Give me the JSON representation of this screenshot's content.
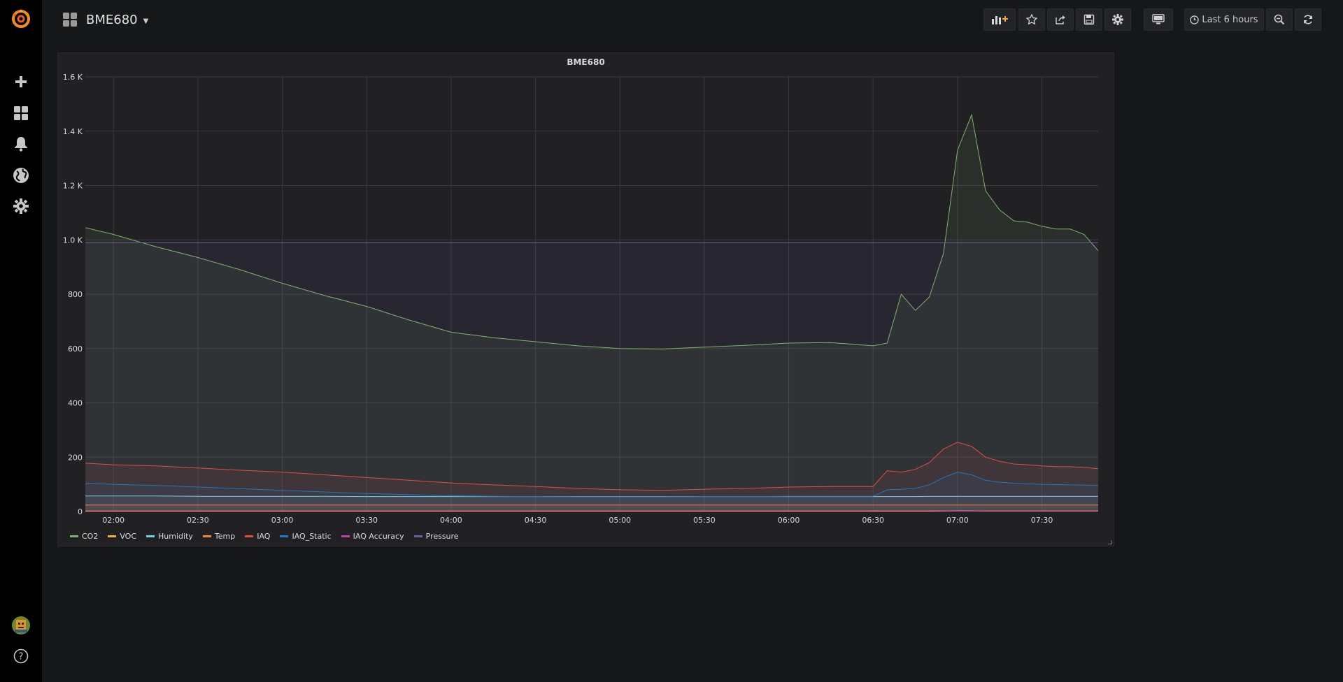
{
  "header": {
    "dashboard_title": "BME680",
    "time_range_label": "Last 6 hours"
  },
  "sidebar": {
    "items": [
      {
        "icon": "grafana-logo-icon"
      },
      {
        "icon": "plus-icon"
      },
      {
        "icon": "dashboards-icon"
      },
      {
        "icon": "bell-icon"
      },
      {
        "icon": "globe-icon"
      },
      {
        "icon": "gear-icon"
      },
      {
        "icon": "avatar"
      },
      {
        "icon": "help-icon"
      }
    ]
  },
  "toolbar": {
    "buttons": [
      {
        "icon": "add-panel-icon"
      },
      {
        "icon": "star-icon"
      },
      {
        "icon": "share-icon"
      },
      {
        "icon": "save-icon"
      },
      {
        "icon": "gear-icon"
      },
      {
        "icon": "monitor-icon"
      },
      {
        "icon": "clock-icon"
      },
      {
        "icon": "zoom-out-icon"
      },
      {
        "icon": "refresh-icon"
      }
    ]
  },
  "panel": {
    "title": "BME680"
  },
  "colors": {
    "CO2": "#7eb26d",
    "VOC": "#eab839",
    "Humidity": "#6ed0e0",
    "Temp": "#ef843c",
    "IAQ": "#e24d42",
    "IAQ_Static": "#1f78c1",
    "IAQ Accuracy": "#ba43a9",
    "Pressure": "#705da0"
  },
  "chart_data": {
    "type": "line",
    "title": "BME680",
    "xlabel": "",
    "ylabel": "",
    "x_ticks": [
      "02:00",
      "02:30",
      "03:00",
      "03:30",
      "04:00",
      "04:30",
      "05:00",
      "05:30",
      "06:00",
      "06:30",
      "07:00",
      "07:30"
    ],
    "y_ticks": [
      "0",
      "200",
      "400",
      "600",
      "800",
      "1.0 K",
      "1.2 K",
      "1.4 K",
      "1.6 K"
    ],
    "ylim": [
      0,
      1600
    ],
    "xlim": [
      "01:50",
      "07:50"
    ],
    "grid": true,
    "legend_position": "bottom-left",
    "x": [
      "01:50",
      "02:00",
      "02:15",
      "02:30",
      "02:45",
      "03:00",
      "03:15",
      "03:30",
      "03:45",
      "04:00",
      "04:15",
      "04:30",
      "04:45",
      "05:00",
      "05:15",
      "05:30",
      "05:45",
      "06:00",
      "06:15",
      "06:30",
      "06:35",
      "06:40",
      "06:45",
      "06:50",
      "06:55",
      "07:00",
      "07:05",
      "07:10",
      "07:15",
      "07:20",
      "07:25",
      "07:30",
      "07:35",
      "07:40",
      "07:45",
      "07:50"
    ],
    "series": [
      {
        "name": "CO2",
        "values": [
          1045,
          1020,
          975,
          935,
          890,
          840,
          795,
          755,
          705,
          660,
          640,
          625,
          610,
          600,
          598,
          605,
          612,
          620,
          622,
          610,
          620,
          800,
          740,
          790,
          950,
          1330,
          1460,
          1180,
          1110,
          1070,
          1065,
          1050,
          1040,
          1040,
          1020,
          960
        ]
      },
      {
        "name": "VOC",
        "values": [
          1,
          1,
          1,
          1,
          1,
          1,
          1,
          1,
          1,
          1,
          1,
          1,
          1,
          1,
          1,
          1,
          1,
          1,
          1,
          1,
          1,
          1,
          1,
          1,
          2,
          3,
          3,
          2,
          2,
          2,
          2,
          2,
          2,
          2,
          2,
          2
        ]
      },
      {
        "name": "Humidity",
        "values": [
          57,
          57,
          57,
          56,
          56,
          56,
          56,
          55,
          55,
          55,
          55,
          55,
          55,
          55,
          55,
          55,
          55,
          55,
          55,
          55,
          55,
          55,
          55,
          56,
          56,
          56,
          56,
          56,
          56,
          56,
          56,
          56,
          56,
          56,
          56,
          56
        ]
      },
      {
        "name": "Temp",
        "values": [
          24,
          24,
          24,
          24,
          24,
          24,
          24,
          24,
          24,
          24,
          24,
          24,
          24,
          24,
          24,
          24,
          24,
          24,
          24,
          24,
          24,
          24,
          24,
          24,
          24,
          24,
          24,
          24,
          24,
          24,
          24,
          24,
          24,
          24,
          24,
          24
        ]
      },
      {
        "name": "IAQ",
        "values": [
          178,
          172,
          168,
          160,
          152,
          145,
          135,
          125,
          115,
          105,
          98,
          92,
          85,
          80,
          78,
          82,
          85,
          90,
          92,
          92,
          150,
          145,
          155,
          180,
          230,
          255,
          240,
          200,
          185,
          175,
          172,
          168,
          165,
          165,
          162,
          158
        ]
      },
      {
        "name": "IAQ_Static",
        "values": [
          105,
          100,
          96,
          90,
          84,
          78,
          72,
          66,
          62,
          58,
          56,
          55,
          54,
          54,
          54,
          55,
          55,
          56,
          56,
          56,
          80,
          82,
          85,
          98,
          125,
          145,
          135,
          115,
          108,
          104,
          102,
          100,
          99,
          98,
          97,
          96
        ]
      },
      {
        "name": "IAQ Accuracy",
        "values": [
          3,
          3,
          3,
          3,
          3,
          3,
          3,
          3,
          3,
          3,
          3,
          3,
          3,
          3,
          3,
          3,
          3,
          3,
          3,
          3,
          3,
          3,
          3,
          3,
          3,
          3,
          3,
          3,
          3,
          3,
          3,
          3,
          3,
          3,
          3,
          3
        ]
      },
      {
        "name": "Pressure",
        "values": [
          990,
          990,
          990,
          990,
          990,
          990,
          990,
          990,
          990,
          990,
          990,
          990,
          990,
          990,
          990,
          990,
          990,
          990,
          990,
          990,
          990,
          990,
          990,
          990,
          990,
          990,
          990,
          990,
          990,
          990,
          990,
          990,
          990,
          990,
          990,
          990
        ]
      }
    ]
  }
}
